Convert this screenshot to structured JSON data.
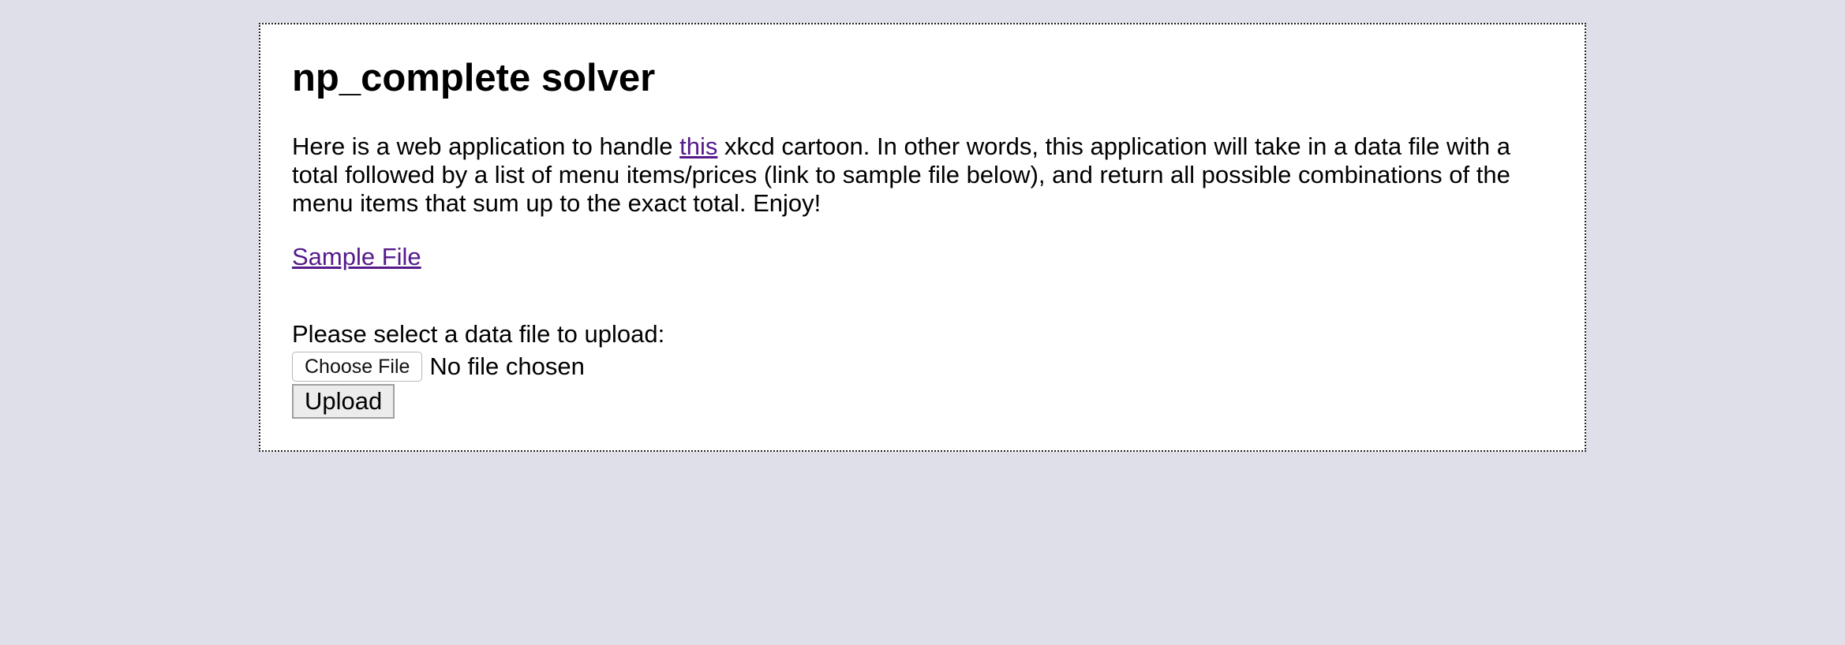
{
  "page": {
    "title": "np_complete solver",
    "intro": {
      "before_link": "Here is a web application to handle ",
      "link_text": "this",
      "after_link": " xkcd cartoon. In other words, this application will take in a data file with a total followed by a list of menu items/prices (link to sample file below), and return all possible combinations of the menu items that sum up to the exact total. Enjoy!"
    },
    "sample_link": "Sample File",
    "upload_form": {
      "prompt": "Please select a data file to upload:",
      "choose_file_label": "Choose File",
      "file_status": "No file chosen",
      "upload_label": "Upload"
    }
  },
  "colors": {
    "background": "#dfdfe9",
    "card": "#ffffff",
    "visited_link": "#551a8b"
  }
}
